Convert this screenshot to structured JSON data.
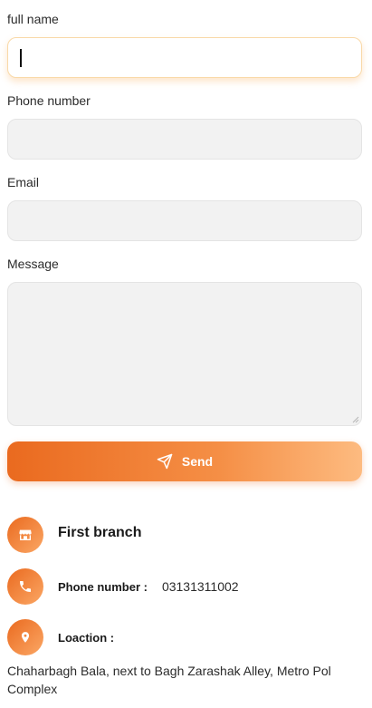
{
  "form": {
    "full_name": {
      "label": "full name",
      "value": ""
    },
    "phone": {
      "label": "Phone number",
      "value": ""
    },
    "email": {
      "label": "Email",
      "value": ""
    },
    "message": {
      "label": "Message",
      "value": ""
    },
    "send_label": "Send"
  },
  "branch": {
    "title": "First branch",
    "phone_label": "Phone number :",
    "phone_value": "03131311002",
    "location_label": "Loaction :",
    "address": "Chaharbagh Bala, next to Bagh Zarashak Alley, Metro Pol Complex"
  },
  "icons": {
    "send": "send-icon",
    "store": "store-icon",
    "phone": "phone-icon",
    "location": "location-pin-icon"
  },
  "colors": {
    "accent_start": "#ea6a1f",
    "accent_end": "#fdbb80",
    "field_bg": "#f2f2f2"
  }
}
